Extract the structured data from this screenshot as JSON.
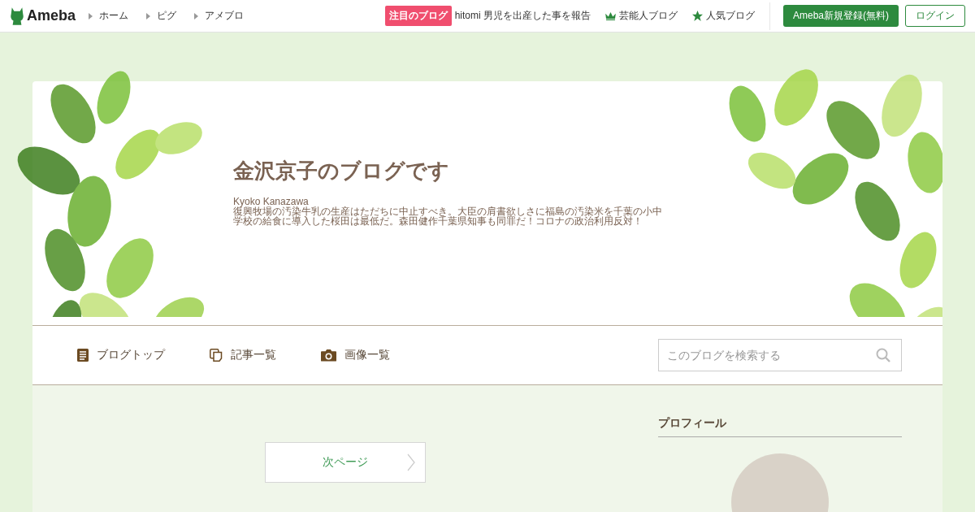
{
  "header": {
    "logo": "Ameba",
    "nav": [
      {
        "label": "ホーム"
      },
      {
        "label": "ピグ"
      },
      {
        "label": "アメブロ"
      }
    ],
    "featured": {
      "badge": "注目のブログ",
      "text": "hitomi 男児を出産した事を報告"
    },
    "links": [
      {
        "kind": "crown",
        "label": "芸能人ブログ"
      },
      {
        "kind": "star",
        "label": "人気ブログ"
      }
    ],
    "register_button": "Ameba新規登録(無料)",
    "login_button": "ログイン"
  },
  "blog": {
    "title": "金沢京子のブログです",
    "author": "Kyoko Kanazawa",
    "description": "復興牧場の汚染牛乳の生産はただちに中止すべき。大臣の肩書欲しさに福島の汚染米を千葉の小中学校の給食に導入した桜田は最低だ。森田健作千葉県知事も同罪だ！コロナの政治利用反対！"
  },
  "blog_nav": [
    {
      "kind": "document",
      "label": "ブログトップ"
    },
    {
      "kind": "pages",
      "label": "記事一覧"
    },
    {
      "kind": "camera",
      "label": "画像一覧"
    }
  ],
  "search": {
    "placeholder": "このブログを検索する"
  },
  "pager": {
    "next": "次ページ"
  },
  "sidebar": {
    "profile_heading": "プロフィール"
  }
}
